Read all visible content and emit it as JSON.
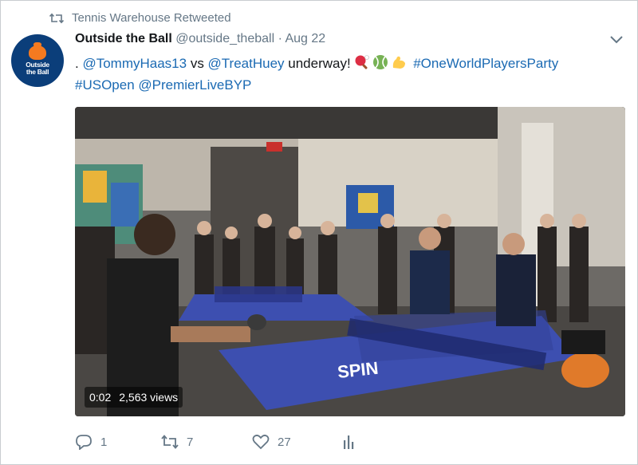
{
  "retweet": {
    "text": "Tennis Warehouse Retweeted"
  },
  "avatar": {
    "line1": "Outside",
    "line2": "the Ball"
  },
  "tweet": {
    "author_name": "Outside the Ball",
    "handle": "@outside_theball",
    "separator": "·",
    "date": "Aug 22",
    "text_prefix": ". ",
    "mention1": "@TommyHaas13",
    "vs": " vs ",
    "mention2": "@TreatHuey",
    "underway": " underway!",
    "hashtag1": "#OneWorldPlayersParty",
    "hashtag2": "#USOpen",
    "mention3": "@PremierLiveBYP"
  },
  "media": {
    "table_brand": "SPIN",
    "time": "0:02",
    "views": "2,563 views"
  },
  "actions": {
    "replies": "1",
    "retweets": "7",
    "likes": "27"
  },
  "colors": {
    "link": "#1b6ab3",
    "muted": "#657786",
    "table_blue": "#3d4fb0",
    "avatar_bg": "#0b3e7a"
  }
}
